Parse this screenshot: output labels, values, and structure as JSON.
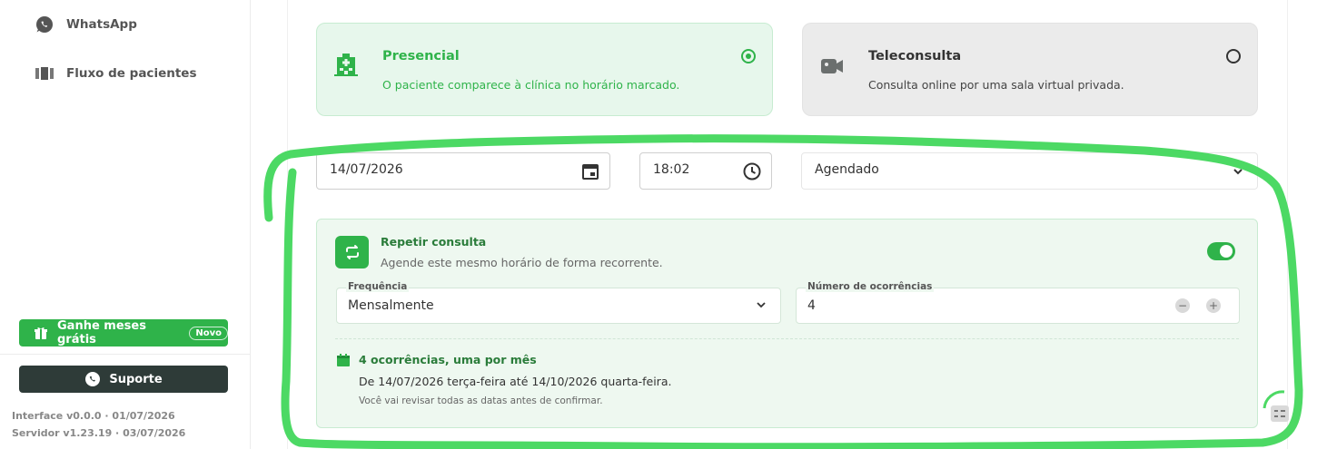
{
  "sidebar": {
    "items": [
      {
        "label": "WhatsApp",
        "icon": "whatsapp-icon"
      },
      {
        "label": "Fluxo de pacientes",
        "icon": "patient-flow-icon"
      }
    ],
    "gift_button": {
      "label": "Ganhe meses grátis",
      "badge": "Novo"
    },
    "support_button": {
      "label": "Suporte"
    },
    "version_interface": "Interface v0.0.0 · 01/07/2026",
    "version_server": "Servidor v1.23.19 · 03/07/2026"
  },
  "appointment_type": {
    "options": [
      {
        "title": "Presencial",
        "description": "O paciente comparece à clínica no horário marcado.",
        "selected": true,
        "icon": "hospital-icon"
      },
      {
        "title": "Teleconsulta",
        "description": "Consulta online por uma sala virtual privada.",
        "selected": false,
        "icon": "video-camera-icon"
      }
    ]
  },
  "schedule": {
    "date": "14/07/2026",
    "time": "18:02",
    "status": "Agendado"
  },
  "repeat": {
    "title": "Repetir consulta",
    "subtitle": "Agende este mesmo horário de forma recorrente.",
    "enabled": true,
    "frequency_label": "Frequência",
    "frequency_value": "Mensalmente",
    "occurrences_label": "Número de ocorrências",
    "occurrences_value": "4",
    "summary_title": "4 ocorrências, uma por mês",
    "summary_range": "De 14/07/2026 terça-feira até 14/10/2026 quarta-feira.",
    "summary_note": "Você vai revisar todas as datas antes de confirmar."
  },
  "colors": {
    "accent": "#2fb34a",
    "annotation": "#4cd964"
  }
}
